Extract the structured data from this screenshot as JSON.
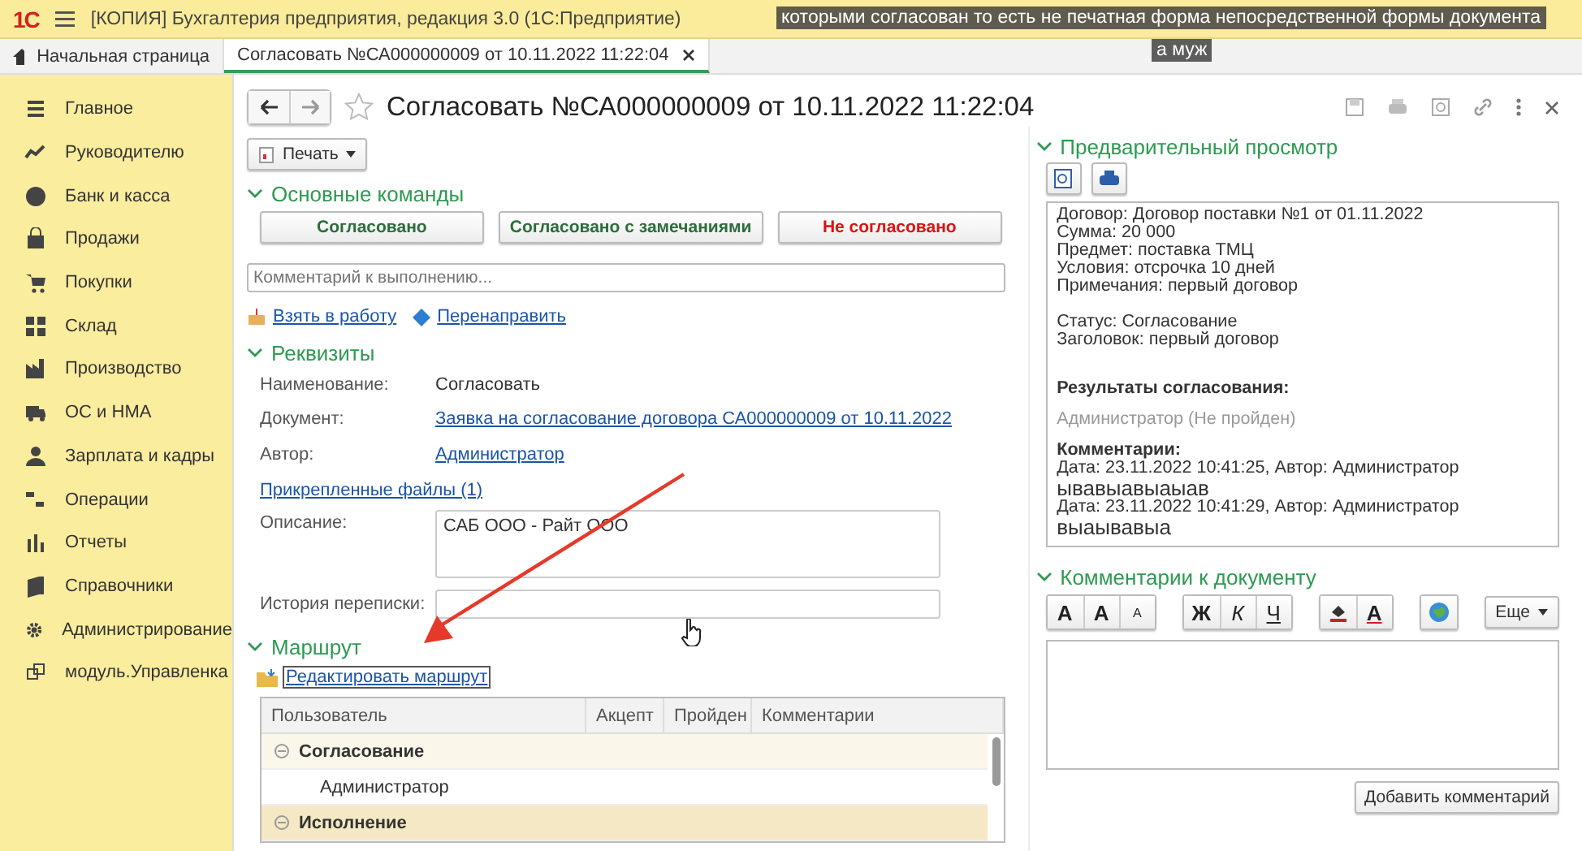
{
  "title_bar": {
    "logo": "1С",
    "title": "[КОПИЯ] Бухгалтерия предприятия, редакция 3.0  (1С:Предприятие)"
  },
  "video_captions": [
    "которыми согласован то есть не печатная форма непосредственной формы документа",
    "а муж"
  ],
  "tabs": [
    {
      "label": "Начальная страница",
      "kind": "home",
      "selected": false
    },
    {
      "label": "Согласовать №СА000000009 от 10.11.2022 11:22:04",
      "kind": "document",
      "selected": true
    }
  ],
  "sidebar": {
    "items": [
      {
        "label": "Главное",
        "kind": "main"
      },
      {
        "label": "Руководителю",
        "kind": "chart"
      },
      {
        "label": "Банк и касса",
        "kind": "bank"
      },
      {
        "label": "Продажи",
        "kind": "sales"
      },
      {
        "label": "Покупки",
        "kind": "cart"
      },
      {
        "label": "Склад",
        "kind": "grid"
      },
      {
        "label": "Производство",
        "kind": "factory"
      },
      {
        "label": "ОС и НМА",
        "kind": "truck"
      },
      {
        "label": "Зарплата и кадры",
        "kind": "person"
      },
      {
        "label": "Операции",
        "kind": "ops"
      },
      {
        "label": "Отчеты",
        "kind": "bars"
      },
      {
        "label": "Справочники",
        "kind": "book"
      },
      {
        "label": "Администрирование",
        "kind": "gear"
      },
      {
        "label": "модуль.Управленка",
        "kind": "link"
      }
    ]
  },
  "form": {
    "title": "Согласовать №СА000000009 от 10.11.2022 11:22:04",
    "print_button": "Печать",
    "main_commands": {
      "title": "Основные команды",
      "expanded": true,
      "buttons": [
        {
          "label": "Согласовано",
          "kind": "positive"
        },
        {
          "label": "Согласовано с замечаниями",
          "kind": "positive"
        },
        {
          "label": "Не согласовано",
          "kind": "negative"
        }
      ]
    },
    "comment_field": {
      "placeholder": "Комментарий к выполнению..."
    },
    "actions": [
      {
        "label": "Взять в работу",
        "kind": "take"
      },
      {
        "label": "Перенаправить",
        "kind": "forward"
      }
    ],
    "details": {
      "title": "Реквизиты",
      "expanded": true,
      "name_label": "Наименование:",
      "name_value": "Согласовать",
      "document_label": "Документ:",
      "document_link": "Заявка на согласование договора СА000000009 от 10.11.2022",
      "author_label": "Автор:",
      "author_link": "Администратор",
      "attachments_link": "Прикрепленные файлы (1)",
      "description_label": "Описание:",
      "description_value": "САБ ООО - Райт ООО",
      "history_label": "История переписки:"
    },
    "route": {
      "title": "Маршрут",
      "expanded": true,
      "edit_link": "Редактировать маршрут",
      "table": {
        "columns": [
          "Пользователь",
          "Акцепт",
          "Пройден",
          "Комментарии"
        ],
        "rows": [
          {
            "label": "Согласование",
            "expanded": true,
            "selected": false,
            "children": [
              {
                "label": "Администратор",
                "selected": false
              }
            ]
          },
          {
            "label": "Исполнение",
            "expanded": true,
            "selected": true
          }
        ]
      }
    },
    "preview": {
      "title": "Предварительный просмотр",
      "expanded": true,
      "lines": [
        {
          "text": "Договор: Договор поставки №1 от 01.11.2022",
          "kind": "plain"
        },
        {
          "text": "Сумма: 20 000",
          "kind": "plain"
        },
        {
          "text": "Предмет: поставка ТМЦ",
          "kind": "plain"
        },
        {
          "text": "Условия: отсрочка 10 дней",
          "kind": "plain"
        },
        {
          "text": "Примечания: первый договор",
          "kind": "plain"
        },
        {
          "kind": "gap"
        },
        {
          "text": "Статус: Согласование",
          "kind": "plain"
        },
        {
          "text": "Заголовок: первый договор",
          "kind": "plain"
        },
        {
          "kind": "gap"
        },
        {
          "text": "Результаты согласования:",
          "kind": "bold"
        },
        {
          "text": "Администратор (Не пройден)",
          "kind": "muted"
        },
        {
          "text": "Комментарии:",
          "kind": "bold"
        },
        {
          "text": "Дата: 23.11.2022 10:41:25, Автор: Администратор",
          "kind": "plain"
        },
        {
          "text": "ывавыавыаыав",
          "kind": "large"
        },
        {
          "text": "Дата: 23.11.2022 10:41:29, Автор: Администратор",
          "kind": "plain"
        },
        {
          "text": "выаывавыа",
          "kind": "large"
        }
      ]
    },
    "doc_comments": {
      "title": "Комментарии к документу",
      "expanded": true,
      "format_groups": [
        [
          {
            "kind": "font",
            "label": "A"
          },
          {
            "kind": "grow",
            "label": "A"
          },
          {
            "kind": "shrink",
            "label": "A"
          }
        ],
        [
          {
            "kind": "bold",
            "label": "Ж"
          },
          {
            "kind": "italic",
            "label": "К"
          },
          {
            "kind": "underline",
            "label": "Ч"
          }
        ],
        [
          {
            "kind": "fill"
          },
          {
            "kind": "color",
            "label": "A"
          }
        ],
        [
          {
            "kind": "image"
          }
        ]
      ],
      "more_button": "Еще",
      "add_button": "Добавить комментарий"
    }
  }
}
